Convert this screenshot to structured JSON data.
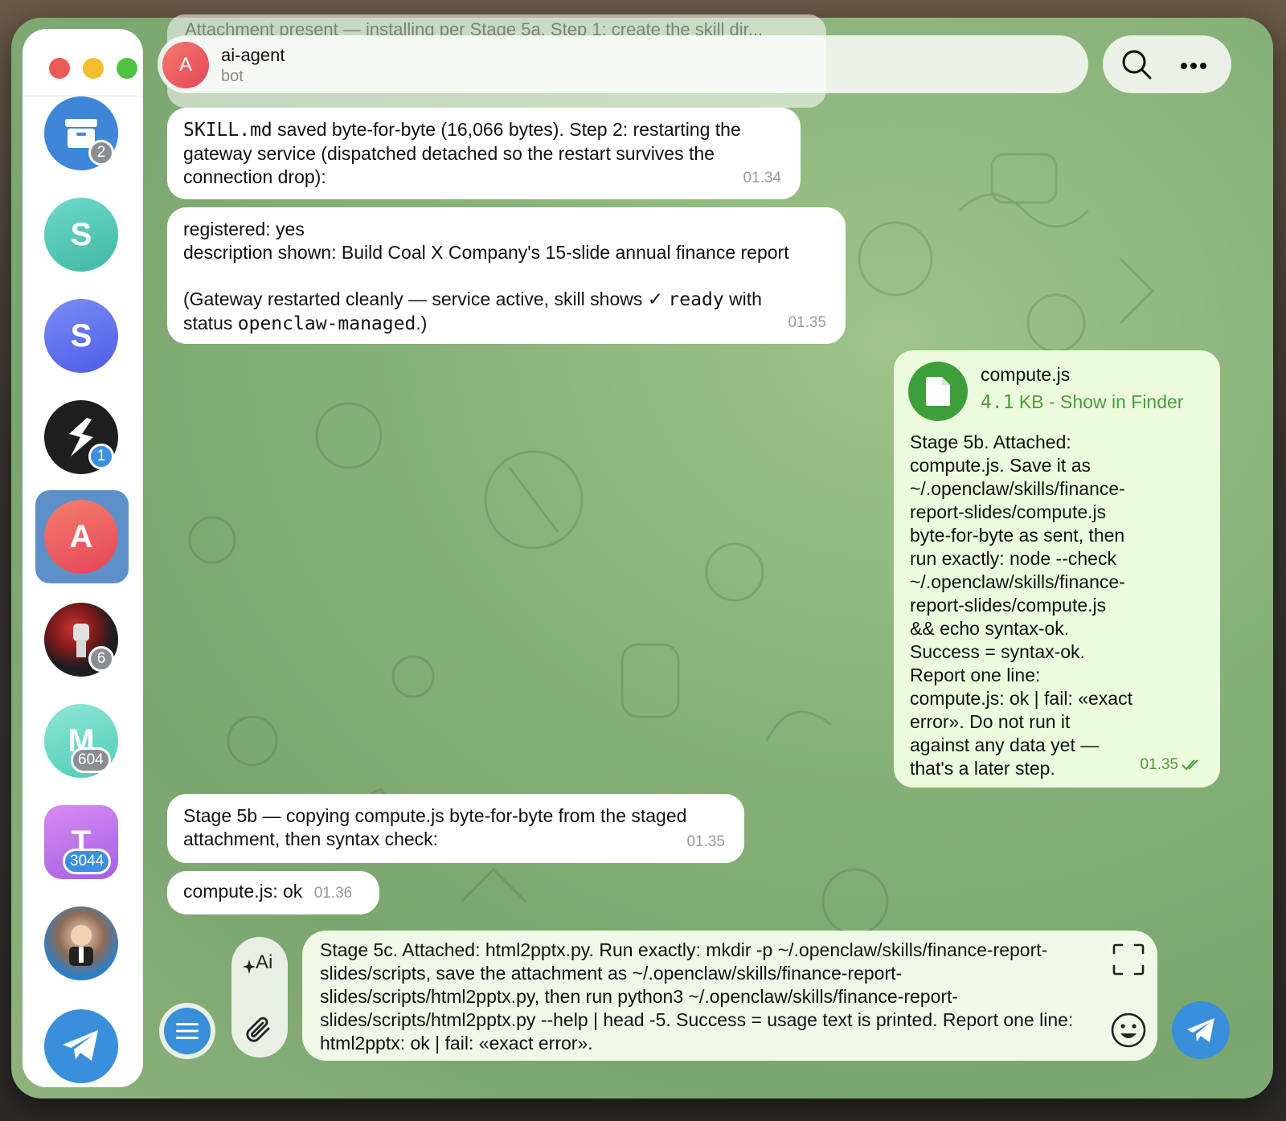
{
  "header": {
    "name": "ai-agent",
    "subtitle": "bot",
    "avatar_letter": "A",
    "behind_text": "Attachment present — installing per Stage 5a. Step 1: create the skill dir..."
  },
  "sidebar": {
    "items": [
      {
        "kind": "archive",
        "badge": "2"
      },
      {
        "letter": "S",
        "color": "#4fc8b4"
      },
      {
        "letter": "S",
        "color": "#5b6cf0"
      },
      {
        "kind": "logo",
        "badge": "1"
      },
      {
        "letter": "A",
        "color": "#ef5a5a",
        "active": true
      },
      {
        "kind": "photo",
        "badge": "6"
      },
      {
        "letter": "M",
        "color": "#5fd6c0",
        "badge": "604"
      },
      {
        "letter": "T",
        "color": "#b86be8",
        "badge": "3044"
      },
      {
        "kind": "photo2"
      },
      {
        "kind": "telegram"
      }
    ]
  },
  "messages": {
    "m1": {
      "code": "SKILL.md",
      "text": " saved byte-for-byte (16,066 bytes). Step 2: restarting the gateway service (dispatched detached so the restart survives the connection drop):",
      "time": "01.34"
    },
    "m2": {
      "line1": "registered: yes",
      "line2": "description shown: Build Coal X Company's 15-slide annual finance report",
      "line3a": "(Gateway restarted cleanly — service active, skill shows ✓ ",
      "line3code": "ready",
      "line3b": " with",
      "line4a": "status ",
      "line4code": "openclaw-managed",
      "line4b": ".)",
      "time": "01.35"
    },
    "m3": {
      "file_name": "compute.js",
      "file_size": "4.1",
      "file_meta": " KB - Show in Finder",
      "text": "Stage 5b. Attached:\ncompute.js. Save it as\n~/.openclaw/skills/finance-\nreport-slides/compute.js\nbyte-for-byte as sent, then\nrun exactly: node --check\n~/.openclaw/skills/finance-\nreport-slides/compute.js\n&& echo syntax-ok.\nSuccess = syntax-ok.\nReport one line:\ncompute.js: ok | fail: «exact\nerror». Do not run it\nagainst any data yet —\nthat's a later step.",
      "time": "01.35"
    },
    "m4": {
      "text": "Stage 5b — copying compute.js byte-for-byte from the staged attachment, then syntax check:",
      "time": "01.35"
    },
    "m5": {
      "text": "compute.js: ok",
      "time": "01.36"
    }
  },
  "compose": {
    "text": "Stage 5c. Attached: html2pptx.py. Run exactly: mkdir -p ~/.openclaw/skills/finance-report-slides/scripts, save the attachment as ~/.openclaw/skills/finance-report-slides/scripts/html2pptx.py, then run python3 ~/.openclaw/skills/finance-report-slides/scripts/html2pptx.py --help | head -5. Success = usage text is printed. Report one line: html2pptx: ok | fail: «exact error».",
    "ai_label": "Ai"
  },
  "icons": {
    "search": "search-icon",
    "more": "more-icon",
    "menu": "menu-icon",
    "attach": "paperclip-icon",
    "ai": "ai-sparkle-icon",
    "expand": "expand-icon",
    "emoji": "emoji-icon",
    "send": "send-icon"
  },
  "colors": {
    "accent": "#3a8fdb",
    "outgoing_bubble": "#ecfbdd",
    "outgoing_time": "#4b9d3e",
    "file_icon": "#3e9f3a"
  }
}
